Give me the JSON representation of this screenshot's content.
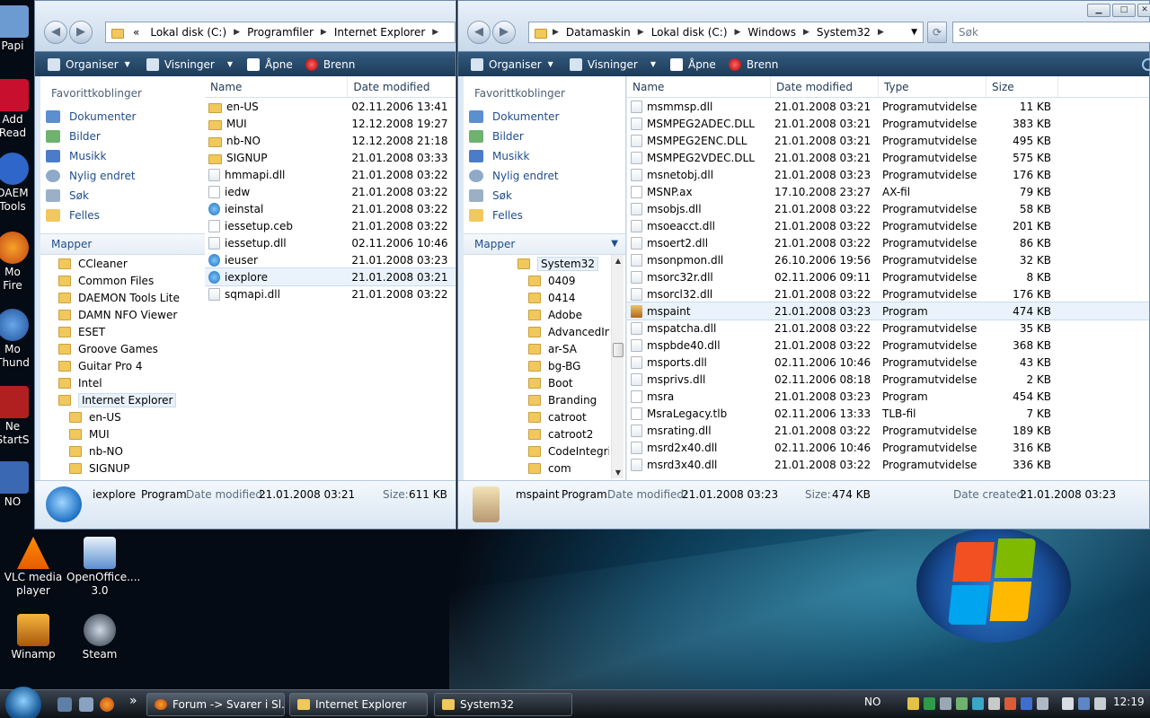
{
  "desktop": {
    "partial_labels": [
      {
        "name": "desktop-item-picasa",
        "label": "Papi"
      },
      {
        "name": "desktop-item-adobe-reader",
        "label": "Add\nRead"
      },
      {
        "name": "desktop-item-daemon",
        "label": "DAEM\nTools"
      },
      {
        "name": "desktop-item-firefox",
        "label": "Mo\nFire"
      },
      {
        "name": "desktop-item-thunderbird",
        "label": "Mo\nThund"
      },
      {
        "name": "desktop-item-startserver",
        "label": "Ne\nStartS"
      },
      {
        "name": "desktop-item-no",
        "label": "NO"
      }
    ],
    "icons": [
      {
        "name": "vlc",
        "label": "VLC media\nplayer"
      },
      {
        "name": "openoffice",
        "label": "OpenOffice....\n3.0"
      },
      {
        "name": "winamp",
        "label": "Winamp"
      },
      {
        "name": "steam",
        "label": "Steam"
      }
    ]
  },
  "left_window": {
    "address": [
      "«",
      "Lokal disk (C:)",
      "Programfiler",
      "Internet Explorer"
    ],
    "toolbar": {
      "organize": "Organiser",
      "views": "Visninger",
      "open": "Åpne",
      "burn": "Brenn"
    },
    "favorites_title": "Favorittkoblinger",
    "favorites": [
      "Dokumenter",
      "Bilder",
      "Musikk",
      "Nylig endret",
      "Søk",
      "Felles"
    ],
    "folders_title": "Mapper",
    "tree": [
      {
        "label": "CCleaner",
        "level": 0
      },
      {
        "label": "Common Files",
        "level": 0
      },
      {
        "label": "DAEMON Tools Lite",
        "level": 0
      },
      {
        "label": "DAMN NFO Viewer",
        "level": 0
      },
      {
        "label": "ESET",
        "level": 0
      },
      {
        "label": "Groove Games",
        "level": 0
      },
      {
        "label": "Guitar Pro 4",
        "level": 0
      },
      {
        "label": "Intel",
        "level": 0
      },
      {
        "label": "Internet Explorer",
        "level": 0,
        "selected": true
      },
      {
        "label": "en-US",
        "level": 1
      },
      {
        "label": "MUI",
        "level": 1
      },
      {
        "label": "nb-NO",
        "level": 1
      },
      {
        "label": "SIGNUP",
        "level": 1
      }
    ],
    "columns": [
      "Name",
      "Date modified"
    ],
    "files": [
      {
        "name": "en-US",
        "date": "02.11.2006 13:41",
        "icon": "folder"
      },
      {
        "name": "MUI",
        "date": "12.12.2008 19:27",
        "icon": "folder"
      },
      {
        "name": "nb-NO",
        "date": "12.12.2008 21:18",
        "icon": "folder"
      },
      {
        "name": "SIGNUP",
        "date": "21.01.2008 03:33",
        "icon": "folder"
      },
      {
        "name": "hmmapi.dll",
        "date": "21.01.2008 03:22",
        "icon": "dll"
      },
      {
        "name": "iedw",
        "date": "21.01.2008 03:22",
        "icon": "exe"
      },
      {
        "name": "ieinstal",
        "date": "21.01.2008 03:22",
        "icon": "ie"
      },
      {
        "name": "iessetup.ceb",
        "date": "21.01.2008 03:22",
        "icon": "file"
      },
      {
        "name": "iessetup.dll",
        "date": "02.11.2006 10:46",
        "icon": "dll"
      },
      {
        "name": "ieuser",
        "date": "21.01.2008 03:23",
        "icon": "ie"
      },
      {
        "name": "iexplore",
        "date": "21.01.2008 03:21",
        "icon": "ie",
        "selected": true
      },
      {
        "name": "sqmapi.dll",
        "date": "21.01.2008 03:22",
        "icon": "dll"
      }
    ],
    "details": {
      "name": "iexplore",
      "type": "Program",
      "modified_label": "Date modified:",
      "modified": "21.01.2008 03:21",
      "size_label": "Size:",
      "size": "611 KB"
    }
  },
  "right_window": {
    "address": [
      "Datamaskin",
      "Lokal disk (C:)",
      "Windows",
      "System32"
    ],
    "search_placeholder": "Søk",
    "toolbar": {
      "organize": "Organiser",
      "views": "Visninger",
      "open": "Åpne",
      "burn": "Brenn"
    },
    "favorites_title": "Favorittkoblinger",
    "favorites": [
      "Dokumenter",
      "Bilder",
      "Musikk",
      "Nylig endret",
      "Søk",
      "Felles"
    ],
    "folders_title": "Mapper",
    "tree": [
      {
        "label": "System32",
        "level": 0
      },
      {
        "label": "0409",
        "level": 1
      },
      {
        "label": "0414",
        "level": 1
      },
      {
        "label": "Adobe",
        "level": 1
      },
      {
        "label": "AdvancedIns",
        "level": 1
      },
      {
        "label": "ar-SA",
        "level": 1
      },
      {
        "label": "bg-BG",
        "level": 1
      },
      {
        "label": "Boot",
        "level": 1
      },
      {
        "label": "Branding",
        "level": 1
      },
      {
        "label": "catroot",
        "level": 1
      },
      {
        "label": "catroot2",
        "level": 1
      },
      {
        "label": "CodeIntegrity",
        "level": 1
      },
      {
        "label": "com",
        "level": 1
      }
    ],
    "columns": [
      "Name",
      "Date modified",
      "Type",
      "Size"
    ],
    "files": [
      {
        "name": "msmmsp.dll",
        "date": "21.01.2008 03:21",
        "type": "Programutvidelse",
        "size": "11 KB",
        "icon": "dll"
      },
      {
        "name": "MSMPEG2ADEC.DLL",
        "date": "21.01.2008 03:21",
        "type": "Programutvidelse",
        "size": "383 KB",
        "icon": "dll"
      },
      {
        "name": "MSMPEG2ENC.DLL",
        "date": "21.01.2008 03:21",
        "type": "Programutvidelse",
        "size": "495 KB",
        "icon": "dll"
      },
      {
        "name": "MSMPEG2VDEC.DLL",
        "date": "21.01.2008 03:21",
        "type": "Programutvidelse",
        "size": "575 KB",
        "icon": "dll"
      },
      {
        "name": "msnetobj.dll",
        "date": "21.01.2008 03:23",
        "type": "Programutvidelse",
        "size": "176 KB",
        "icon": "dll"
      },
      {
        "name": "MSNP.ax",
        "date": "17.10.2008 23:27",
        "type": "AX-fil",
        "size": "79 KB",
        "icon": "file"
      },
      {
        "name": "msobjs.dll",
        "date": "21.01.2008 03:22",
        "type": "Programutvidelse",
        "size": "58 KB",
        "icon": "dll"
      },
      {
        "name": "msoeacct.dll",
        "date": "21.01.2008 03:22",
        "type": "Programutvidelse",
        "size": "201 KB",
        "icon": "dll"
      },
      {
        "name": "msoert2.dll",
        "date": "21.01.2008 03:22",
        "type": "Programutvidelse",
        "size": "86 KB",
        "icon": "dll"
      },
      {
        "name": "msonpmon.dll",
        "date": "26.10.2006 19:56",
        "type": "Programutvidelse",
        "size": "32 KB",
        "icon": "dll"
      },
      {
        "name": "msorc32r.dll",
        "date": "02.11.2006 09:11",
        "type": "Programutvidelse",
        "size": "8 KB",
        "icon": "dll"
      },
      {
        "name": "msorcl32.dll",
        "date": "21.01.2008 03:22",
        "type": "Programutvidelse",
        "size": "176 KB",
        "icon": "dll"
      },
      {
        "name": "mspaint",
        "date": "21.01.2008 03:23",
        "type": "Program",
        "size": "474 KB",
        "icon": "paint",
        "selected": true
      },
      {
        "name": "mspatcha.dll",
        "date": "21.01.2008 03:22",
        "type": "Programutvidelse",
        "size": "35 KB",
        "icon": "dll"
      },
      {
        "name": "mspbde40.dll",
        "date": "21.01.2008 03:22",
        "type": "Programutvidelse",
        "size": "368 KB",
        "icon": "dll"
      },
      {
        "name": "msports.dll",
        "date": "02.11.2006 10:46",
        "type": "Programutvidelse",
        "size": "43 KB",
        "icon": "dll"
      },
      {
        "name": "msprivs.dll",
        "date": "02.11.2006 08:18",
        "type": "Programutvidelse",
        "size": "2 KB",
        "icon": "dll"
      },
      {
        "name": "msra",
        "date": "21.01.2008 03:23",
        "type": "Program",
        "size": "454 KB",
        "icon": "exe"
      },
      {
        "name": "MsraLegacy.tlb",
        "date": "02.11.2006 13:33",
        "type": "TLB-fil",
        "size": "7 KB",
        "icon": "file"
      },
      {
        "name": "msrating.dll",
        "date": "21.01.2008 03:22",
        "type": "Programutvidelse",
        "size": "189 KB",
        "icon": "dll"
      },
      {
        "name": "msrd2x40.dll",
        "date": "02.11.2006 10:46",
        "type": "Programutvidelse",
        "size": "316 KB",
        "icon": "dll"
      },
      {
        "name": "msrd3x40.dll",
        "date": "21.01.2008 03:22",
        "type": "Programutvidelse",
        "size": "336 KB",
        "icon": "dll"
      }
    ],
    "details": {
      "name": "mspaint",
      "type": "Program",
      "modified_label": "Date modified:",
      "modified": "21.01.2008 03:23",
      "size_label": "Size:",
      "size": "474 KB",
      "created_label": "Date created:",
      "created": "21.01.2008 03:23"
    }
  },
  "taskbar": {
    "tasks": [
      {
        "label": "Forum -> Svarer i Sl...",
        "icon": "firefox"
      },
      {
        "label": "Internet Explorer",
        "icon": "folder"
      },
      {
        "label": "System32",
        "icon": "folder",
        "active": true
      }
    ],
    "overflow": "»",
    "language": "NO",
    "clock": "12:19"
  },
  "colors": {
    "accent": "#1e4e8c",
    "toolbar": "#2a4d70",
    "selection": "#eaf3fc"
  }
}
